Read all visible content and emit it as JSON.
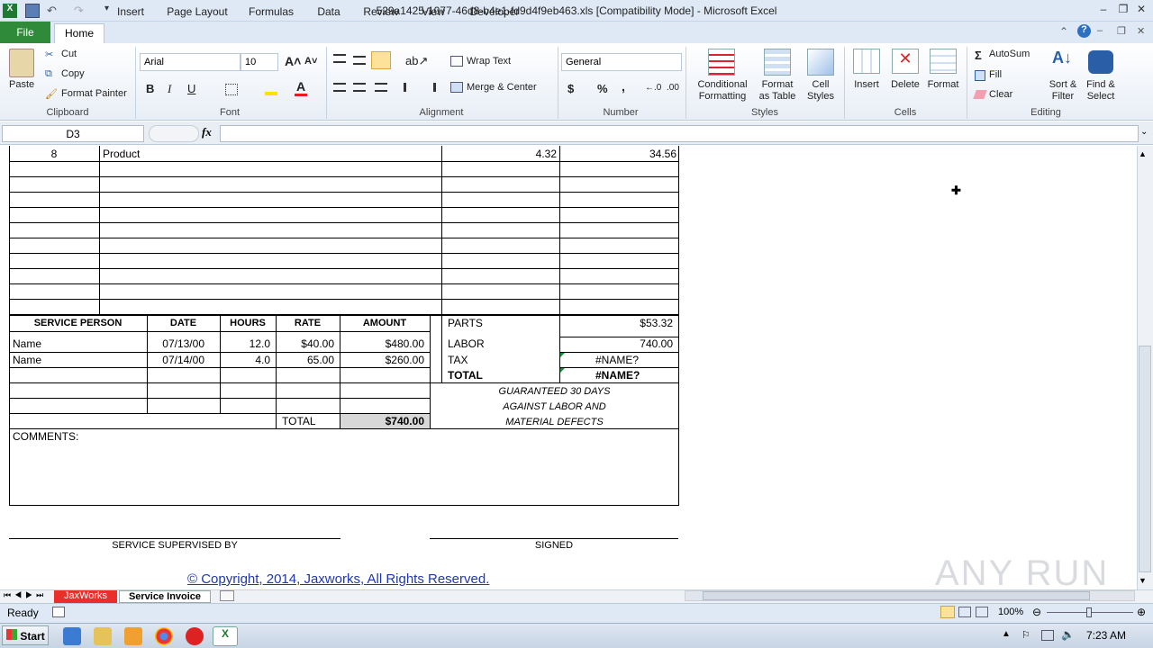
{
  "window": {
    "title": "529a1425-1077-46d8-b4e1-fd9d4f9eb463.xls  [Compatibility Mode]  -  Microsoft Excel"
  },
  "ribbon_tabs": [
    "File",
    "Home",
    "Insert",
    "Page Layout",
    "Formulas",
    "Data",
    "Review",
    "View",
    "Developer"
  ],
  "clipboard": {
    "paste": "Paste",
    "cut": "Cut",
    "copy": "Copy",
    "format_painter": "Format Painter",
    "label": "Clipboard"
  },
  "font": {
    "name": "Arial",
    "size": "10",
    "bold": "B",
    "italic": "I",
    "underline": "U",
    "label": "Font"
  },
  "alignment": {
    "wrap": "Wrap Text",
    "merge": "Merge & Center",
    "label": "Alignment"
  },
  "number": {
    "format": "General",
    "currency": "$",
    "percent": "%",
    "comma": ",",
    "label": "Number"
  },
  "styles": {
    "conditional": "Conditional",
    "conditional2": "Formatting",
    "format_table": "Format",
    "format_table2": "as Table",
    "cell_styles": "Cell",
    "cell_styles2": "Styles",
    "label": "Styles"
  },
  "cells": {
    "insert": "Insert",
    "delete": "Delete",
    "format": "Format",
    "label": "Cells"
  },
  "editing": {
    "autosum": "AutoSum",
    "fill": "Fill",
    "clear": "Clear",
    "sort": "Sort &",
    "sort2": "Filter",
    "find": "Find &",
    "find2": "Select",
    "label": "Editing"
  },
  "formula_bar": {
    "name_box": "D3",
    "fx": "fx",
    "content": ""
  },
  "sheet": {
    "top_row": {
      "qty": "8",
      "desc": "Product",
      "price": "4.32",
      "amount": "34.56"
    },
    "service_headers": [
      "SERVICE PERSON",
      "DATE",
      "HOURS",
      "RATE",
      "AMOUNT"
    ],
    "service_rows": [
      {
        "person": "Name",
        "date": "07/13/00",
        "hours": "12.0",
        "rate": "$40.00",
        "amount": "$480.00"
      },
      {
        "person": "Name",
        "date": "07/14/00",
        "hours": "4.0",
        "rate": "65.00",
        "amount": "$260.00"
      }
    ],
    "service_total_label": "TOTAL",
    "service_total": "$740.00",
    "summary": [
      {
        "label": "PARTS",
        "value": "$53.32"
      },
      {
        "label": "LABOR",
        "value": "740.00"
      },
      {
        "label": "TAX",
        "value": "#NAME?"
      },
      {
        "label": "TOTAL",
        "value": "#NAME?"
      }
    ],
    "guarantee": [
      "GUARANTEED 30 DAYS",
      "AGAINST LABOR AND",
      "MATERIAL DEFECTS"
    ],
    "comments": "COMMENTS:",
    "supervised": "SERVICE SUPERVISED BY",
    "signed": "SIGNED",
    "copyright": "© Copyright, 2014, Jaxworks, All Rights Reserved."
  },
  "sheet_tabs": [
    "JaxWorks",
    "Service Invoice"
  ],
  "status": {
    "ready": "Ready",
    "zoom": "100%"
  },
  "taskbar": {
    "start": "Start",
    "time": "7:23 AM"
  },
  "watermark": "ANY RUN",
  "colors": {
    "file_tab": "#2f8a3a",
    "jaxworks_tab": "#e8302a",
    "link": "#1f37b0"
  }
}
